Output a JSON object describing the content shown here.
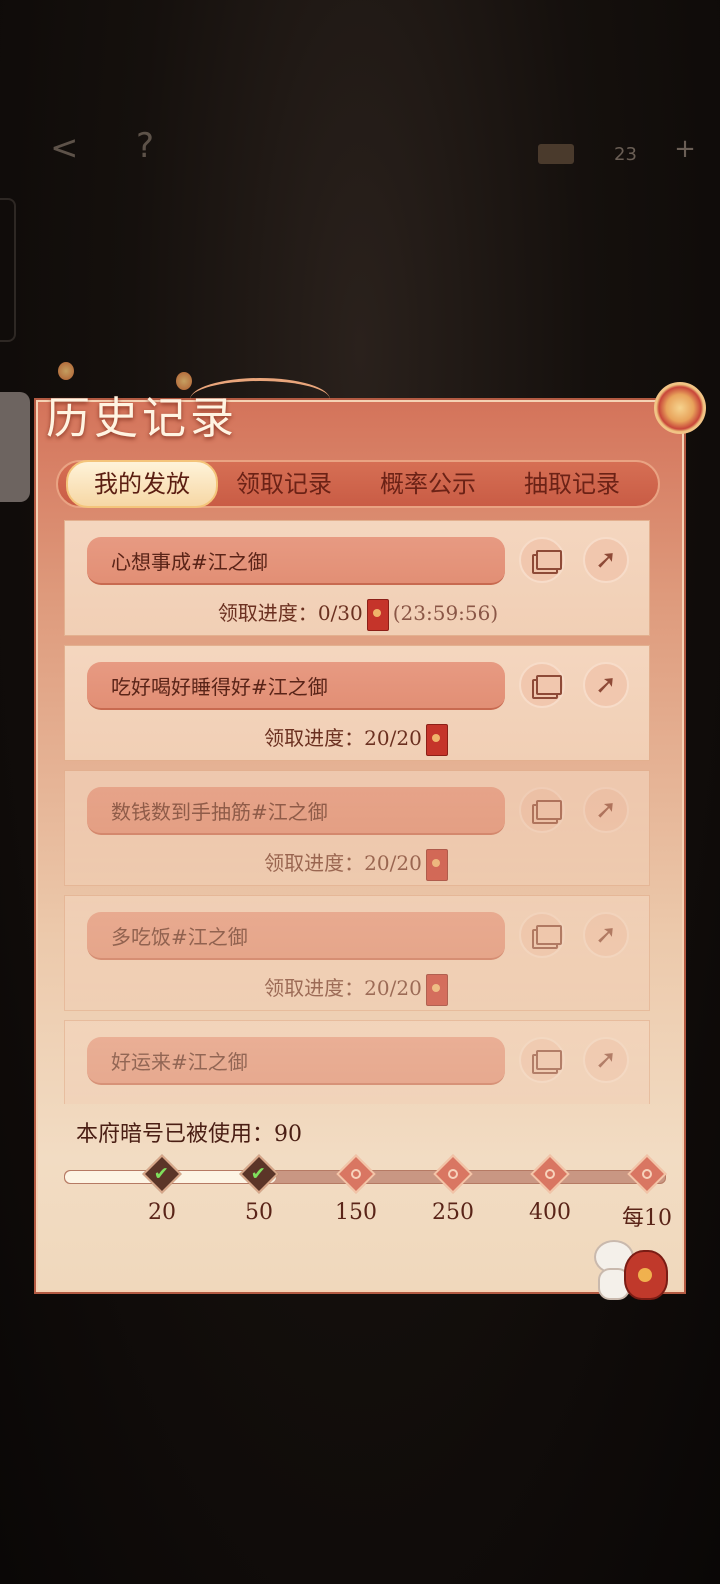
{
  "topbar": {
    "coins": "23"
  },
  "title": "历史记录",
  "tabs": [
    {
      "label": "我的发放",
      "active": true
    },
    {
      "label": "领取记录",
      "active": false
    },
    {
      "label": "概率公示",
      "active": false
    },
    {
      "label": "抽取记录",
      "active": false
    }
  ],
  "records": [
    {
      "name": "心想事成#江之御",
      "progress_label": "领取进度：",
      "progress": "0/30",
      "timer": "(23:59:56)"
    },
    {
      "name": "吃好喝好睡得好#江之御",
      "progress_label": "领取进度：",
      "progress": "20/20",
      "timer": ""
    },
    {
      "name": "数钱数到手抽筋#江之御",
      "progress_label": "领取进度：",
      "progress": "20/20",
      "timer": ""
    },
    {
      "name": "多吃饭#江之御",
      "progress_label": "领取进度：",
      "progress": "20/20",
      "timer": ""
    },
    {
      "name": "好运来#江之御",
      "progress_label": "",
      "progress": "",
      "timer": ""
    }
  ],
  "usage": {
    "label": "本府暗号已被使用：90",
    "value": 90
  },
  "milestones": [
    {
      "label": "20",
      "done": true
    },
    {
      "label": "50",
      "done": true
    },
    {
      "label": "150",
      "done": false
    },
    {
      "label": "250",
      "done": false
    },
    {
      "label": "400",
      "done": false
    },
    {
      "label": "每10",
      "done": false
    }
  ],
  "colors": {
    "accent": "#c95c45",
    "panel": "#ecc9ab",
    "check": "#7fe05d"
  },
  "icons": {
    "back": "back-arrow-icon",
    "help": "help-icon",
    "copy": "copy-icon",
    "share": "share-icon"
  }
}
